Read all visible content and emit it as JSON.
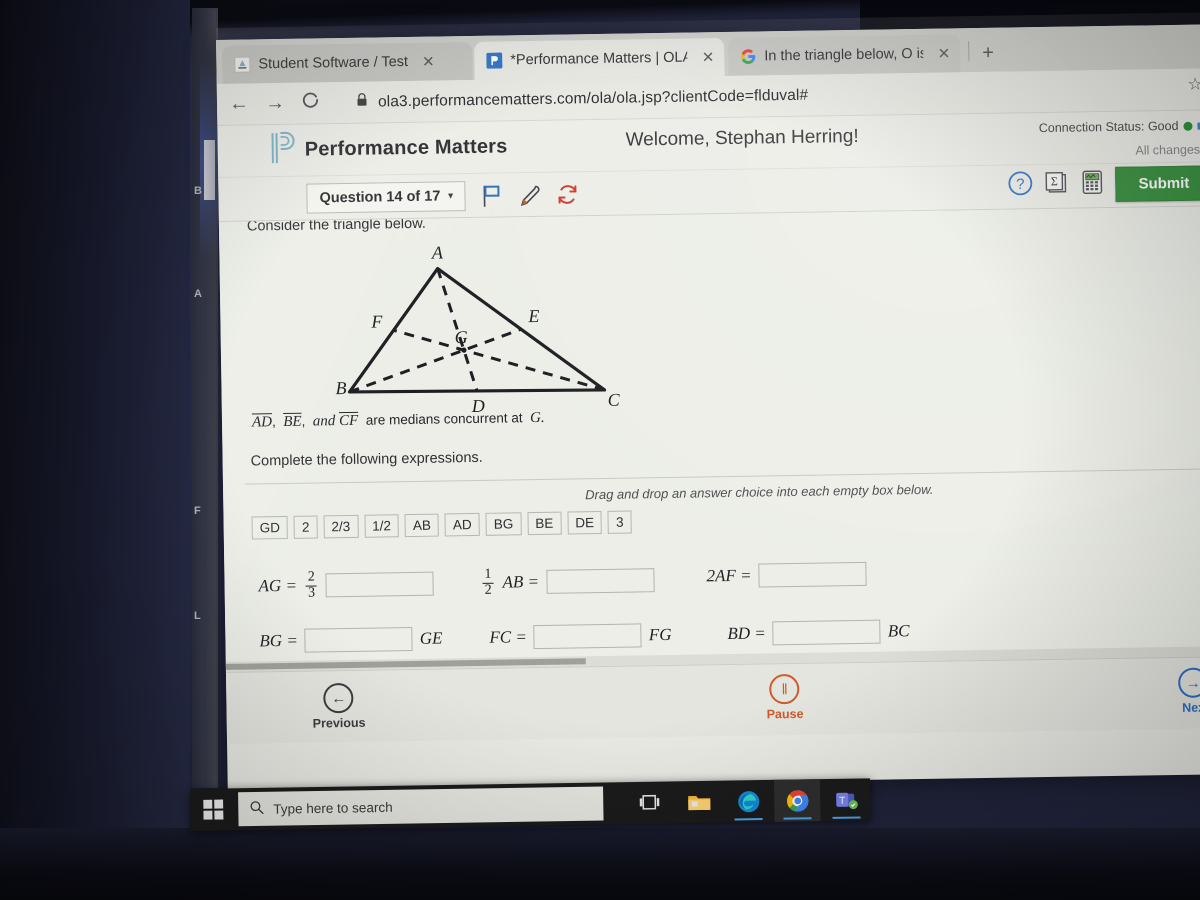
{
  "browser": {
    "tabs": [
      {
        "title": "Student Software / Test",
        "favicon": "student-software-icon",
        "active": false,
        "close_label": "✕"
      },
      {
        "title": "*Performance Matters | OLA",
        "favicon": "performance-matters-icon",
        "active": true,
        "close_label": "✕"
      },
      {
        "title": "In the triangle below, O is the ce",
        "favicon": "google-icon",
        "active": false,
        "close_label": "✕"
      }
    ],
    "new_tab_label": "+",
    "back_icon": "←",
    "forward_icon": "→",
    "reload_icon": "C",
    "lock_icon": "padlock-icon",
    "url": "ola3.performancematters.com/ola/ola.jsp?clientCode=flduval#",
    "bookmark_icon": "☆"
  },
  "app": {
    "logo_text": "Performance Matters",
    "logo_icon": "performance-matters-p-logo",
    "welcome": "Welcome, Stephan Herring!",
    "connection_status": "Connection Status: Good",
    "connection_color": "#1f8a2f",
    "all_changes": "All changes s"
  },
  "toolbar": {
    "question_selector": "Question 14 of 17",
    "caret": "▾",
    "flag_icon": "flag-icon",
    "flag_color": "#2f6fb5",
    "highlighter_icon": "highlighter-icon",
    "highlighter_color": "#d1592a",
    "reset_icon": "reset-icon",
    "reset_color": "#cc3b2e",
    "help_icon": "help-icon",
    "help_color": "#2b6fc4",
    "formula_icon": "formula-sheet-icon",
    "calculator_icon": "calculator-icon",
    "submit_label": "Submit",
    "submit_color": "#2f8a36"
  },
  "question": {
    "stem": "Consider the triangle below.",
    "figure": {
      "name": "triangle-medians-diagram",
      "vertices": {
        "A": "A",
        "B": "B",
        "C": "C"
      },
      "midpoints": {
        "D": "D",
        "E": "E",
        "F": "F"
      },
      "centroid": "G"
    },
    "median_statement": {
      "seg1": "AD",
      "seg2": "BE",
      "and": "and",
      "seg3": "CF",
      "text": "are medians concurrent at",
      "point": "G."
    },
    "instruction": "Complete the following expressions.",
    "drag_tip": "Drag and drop an answer choice into each empty box below.",
    "choices": [
      "GD",
      "2",
      "2/3",
      "1/2",
      "AB",
      "AD",
      "BG",
      "BE",
      "DE",
      "3"
    ],
    "expressions": [
      {
        "id": "ag",
        "lhs": "AG =",
        "frac_num": "2",
        "frac_den": "3",
        "frac_pos": "lhs",
        "box": "",
        "rhs": ""
      },
      {
        "id": "halfab",
        "lhs": "AB =",
        "frac_num": "1",
        "frac_den": "2",
        "frac_pos": "pre",
        "box": "",
        "rhs": ""
      },
      {
        "id": "2af",
        "lhs": "2AF =",
        "frac_num": "",
        "frac_den": "",
        "frac_pos": "none",
        "box": "",
        "rhs": ""
      },
      {
        "id": "bg",
        "lhs": "BG =",
        "frac_num": "",
        "frac_den": "",
        "frac_pos": "none",
        "box": "",
        "rhs": "GE"
      },
      {
        "id": "fc",
        "lhs": "FC =",
        "frac_num": "",
        "frac_den": "",
        "frac_pos": "none",
        "box": "",
        "rhs": "FG"
      },
      {
        "id": "bd",
        "lhs": "BD =",
        "frac_num": "",
        "frac_den": "",
        "frac_pos": "none",
        "box": "",
        "rhs": "BC"
      }
    ]
  },
  "bottom_nav": {
    "previous_label": "Previous",
    "previous_icon": "←",
    "previous_color": "#3b3c40",
    "pause_label": "Pause",
    "pause_icon": "‖",
    "pause_color": "#d1592a",
    "next_label": "Nex",
    "next_icon": "→",
    "next_color": "#2b6fc4"
  },
  "taskbar": {
    "start_icon": "windows-start-icon",
    "search_placeholder": "Type here to search",
    "search_icon": "search-icon",
    "items": [
      {
        "name": "task-view-icon"
      },
      {
        "name": "file-explorer-icon"
      },
      {
        "name": "microsoft-edge-icon"
      },
      {
        "name": "google-chrome-icon"
      },
      {
        "name": "microsoft-teams-icon"
      }
    ]
  },
  "desktop_rail": {
    "letters": [
      "B",
      "A",
      "F",
      "L"
    ]
  }
}
